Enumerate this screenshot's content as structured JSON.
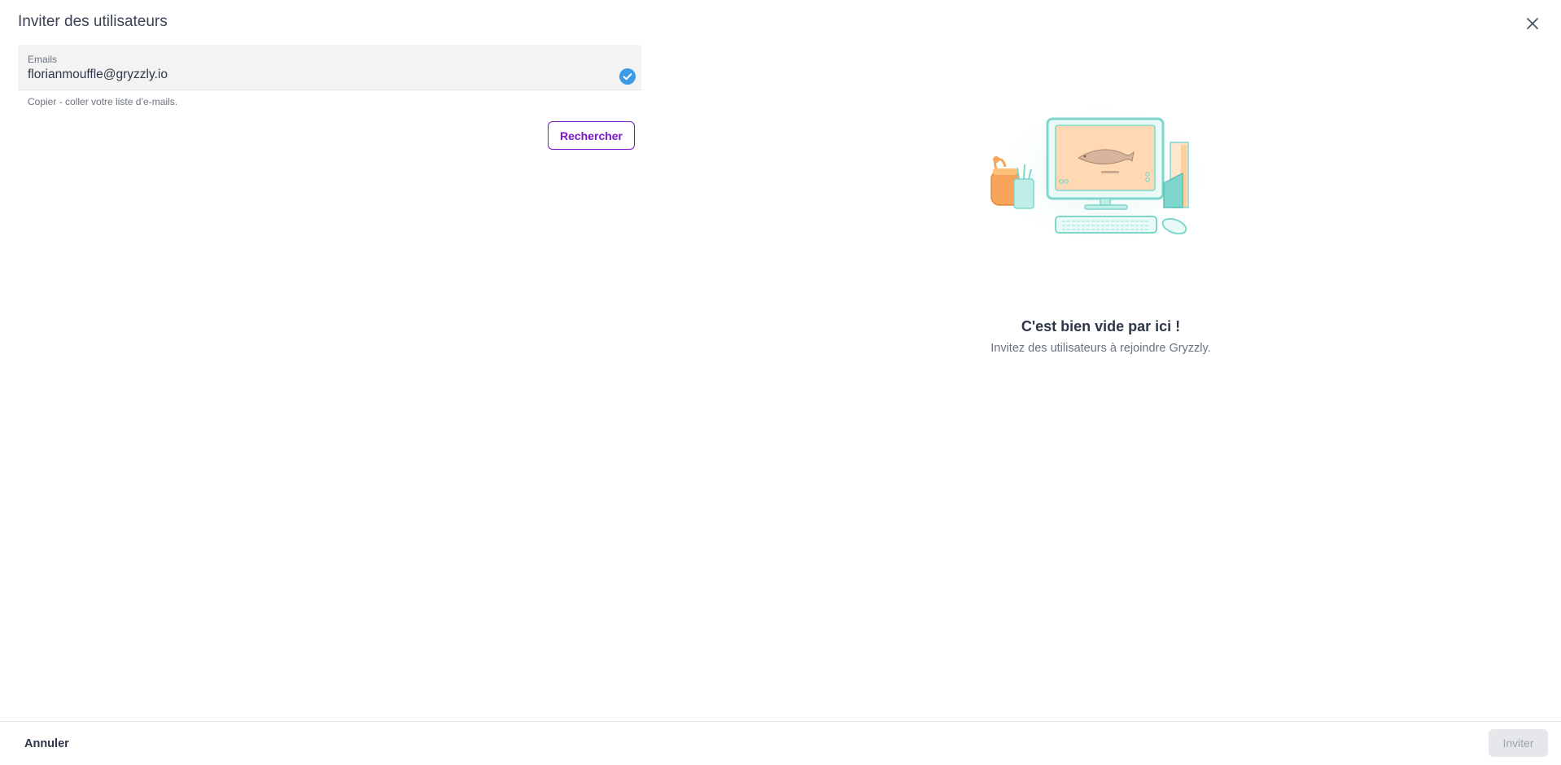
{
  "dialog": {
    "title": "Inviter des utilisateurs"
  },
  "email_field": {
    "label": "Emails",
    "value": "florianmouffle@gryzzly.io",
    "helper": "Copier - coller votre liste d’e-mails.",
    "status_icon": "check-circle-icon"
  },
  "search_button": {
    "label": "Rechercher"
  },
  "empty_state": {
    "title": "C'est bien vide par ici !",
    "subtitle": "Invitez des utilisateurs à rejoindre Gryzzly.",
    "illustration": "computer-desk-illustration"
  },
  "footer": {
    "cancel_label": "Annuler",
    "invite_label": "Inviter"
  },
  "colors": {
    "accent": "#7b16c9",
    "valid": "#3b9be6",
    "teal": "#7fd6cc",
    "orange": "#f7a55a"
  }
}
